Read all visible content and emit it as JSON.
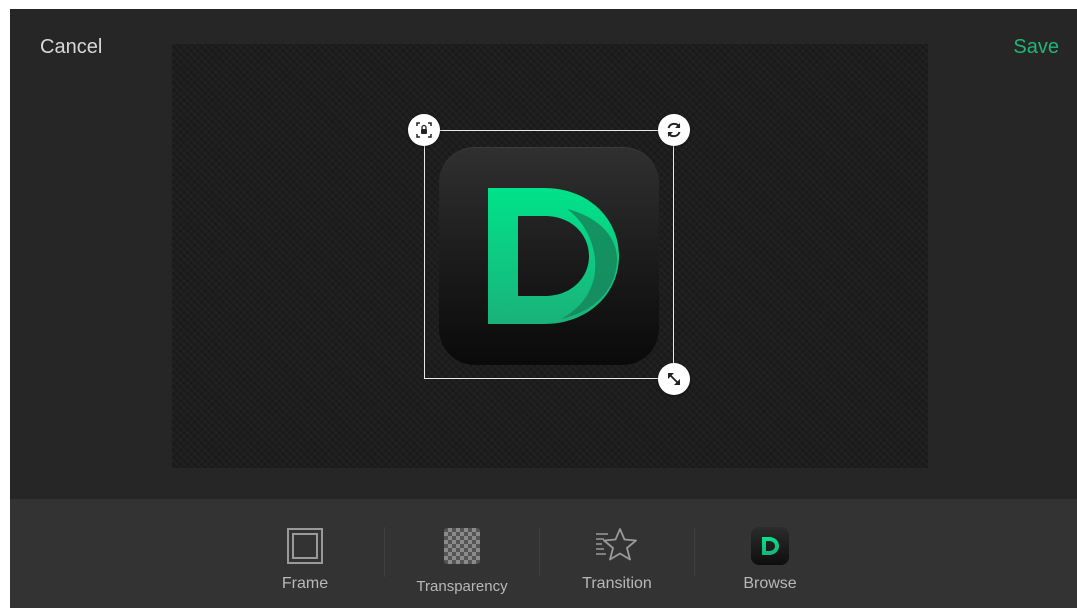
{
  "header": {
    "cancel_label": "Cancel",
    "save_label": "Save"
  },
  "colors": {
    "accent": "#21b57a",
    "logo_green_start": "#00e38a",
    "logo_green_end": "#1ab27a",
    "background": "#262626",
    "toolbar": "#333333"
  },
  "canvas": {
    "selected_item": "d-logo",
    "handles": [
      "lock-icon",
      "rotate-icon",
      "resize-icon"
    ]
  },
  "toolbar": {
    "items": [
      {
        "label": "Frame",
        "icon": "frame-icon"
      },
      {
        "label": "Transparency",
        "icon": "checkerboard-icon"
      },
      {
        "label": "Transition",
        "icon": "star-icon"
      },
      {
        "label": "Browse",
        "icon": "d-app-icon"
      }
    ]
  }
}
